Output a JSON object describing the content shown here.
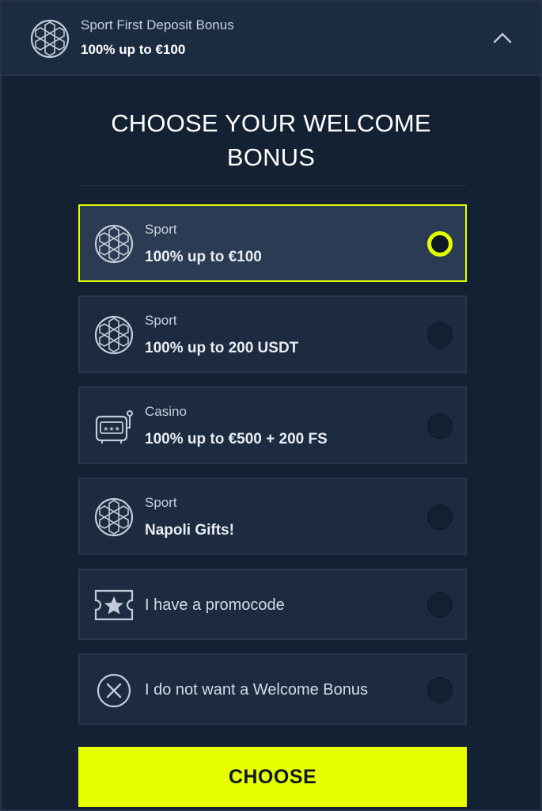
{
  "header": {
    "subtitle": "Sport First Deposit Bonus",
    "title": "100% up to €100",
    "icon": "soccer-ball-icon",
    "toggle_icon": "chevron-up-icon"
  },
  "main": {
    "heading_line1": "CHOOSE YOUR WELCOME",
    "heading_line2": "BONUS",
    "options": [
      {
        "category": "Sport",
        "description": "100% up to €100",
        "icon": "soccer-ball-icon",
        "selected": true
      },
      {
        "category": "Sport",
        "description": "100% up to 200 USDT",
        "icon": "soccer-ball-icon",
        "selected": false
      },
      {
        "category": "Casino",
        "description": "100% up to €500 + 200 FS",
        "icon": "slot-machine-icon",
        "selected": false
      },
      {
        "category": "Sport",
        "description": "Napoli Gifts!",
        "icon": "soccer-ball-icon",
        "selected": false
      },
      {
        "label": "I have a promocode",
        "icon": "ticket-star-icon",
        "selected": false
      },
      {
        "label": "I do not want a Welcome Bonus",
        "icon": "close-circle-icon",
        "selected": false
      }
    ],
    "choose_label": "CHOOSE"
  },
  "colors": {
    "accent": "#e7ff00",
    "background": "#142133",
    "card": "#1c2b40",
    "card_selected": "#2b3b53",
    "header": "#1b2b40"
  }
}
